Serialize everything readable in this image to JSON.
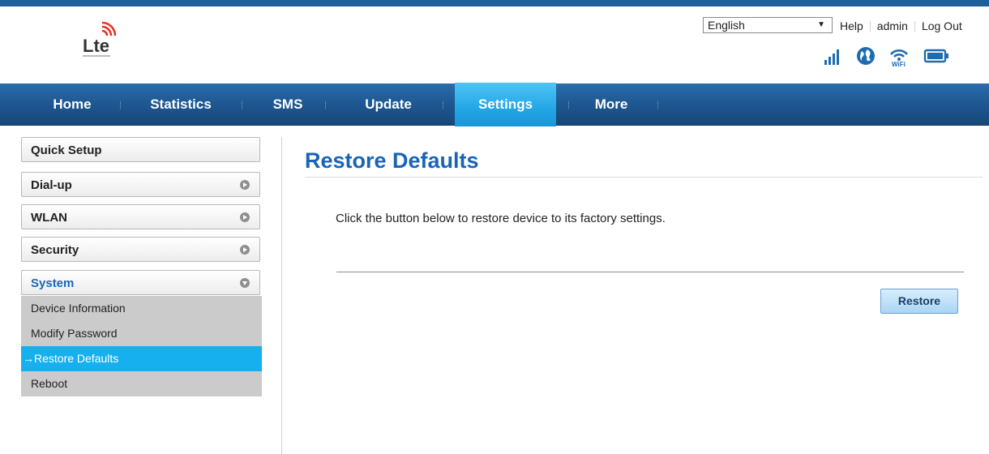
{
  "header": {
    "language": "English",
    "links": {
      "help": "Help",
      "user": "admin",
      "logout": "Log Out"
    },
    "logo_icon": "lte-logo-icon",
    "status_icons": [
      "signal-icon",
      "globe-icon",
      "wifi-icon",
      "battery-icon"
    ]
  },
  "nav": {
    "items": [
      {
        "label": "Home"
      },
      {
        "label": "Statistics"
      },
      {
        "label": "SMS"
      },
      {
        "label": "Update"
      },
      {
        "label": "Settings",
        "active": true
      },
      {
        "label": "More"
      }
    ]
  },
  "sidebar": {
    "sections": [
      {
        "label": "Quick Setup"
      },
      {
        "label": "Dial-up"
      },
      {
        "label": "WLAN"
      },
      {
        "label": "Security"
      },
      {
        "label": "System",
        "expanded": true
      }
    ],
    "system_items": [
      {
        "label": "Device Information"
      },
      {
        "label": "Modify Password"
      },
      {
        "label": "→Restore Defaults",
        "active": true
      },
      {
        "label": "Reboot"
      }
    ]
  },
  "main": {
    "title": "Restore Defaults",
    "instructions": "Click the button below to restore device to its factory settings.",
    "restore_button": "Restore"
  },
  "colors": {
    "brand_blue": "#1a64b5",
    "nav_bg": "#1e5791",
    "active_tab": "#22a6e6",
    "active_subitem": "#16b0ee"
  }
}
